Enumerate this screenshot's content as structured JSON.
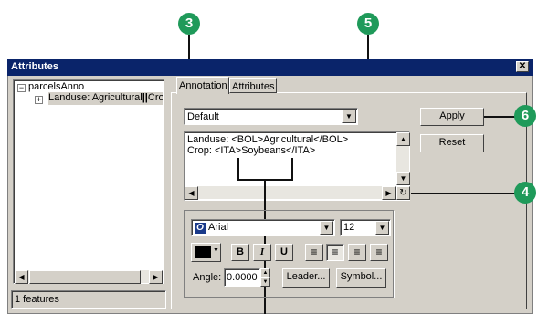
{
  "window": {
    "title": "Attributes",
    "close_glyph": "✕"
  },
  "tree": {
    "root_label": "parcelsAnno",
    "child_label": "Landuse: Agricultural",
    "child_label_suffix": "Crop:",
    "status": "1 features"
  },
  "tabs": [
    {
      "label": "Annotation"
    },
    {
      "label": "Attributes"
    }
  ],
  "annotation": {
    "class_value": "Default",
    "text_lines": [
      "Landuse: <BOL>Agricultural</BOL>",
      "Crop: <ITA>Soybeans</ITA>"
    ],
    "apply_label": "Apply",
    "reset_label": "Reset",
    "font_value": "Arial",
    "size_value": "12",
    "bold_label": "B",
    "italic_label": "I",
    "underline_label": "U",
    "angle_label": "Angle:",
    "angle_value": "0.0000",
    "leader_label": "Leader...",
    "symbol_label": "Symbol..."
  },
  "callouts": [
    "3",
    "5",
    "6",
    "4"
  ],
  "colors": {
    "callout": "#1f9a5a",
    "titlebar": "#0a246a",
    "face": "#d4d0c8"
  }
}
